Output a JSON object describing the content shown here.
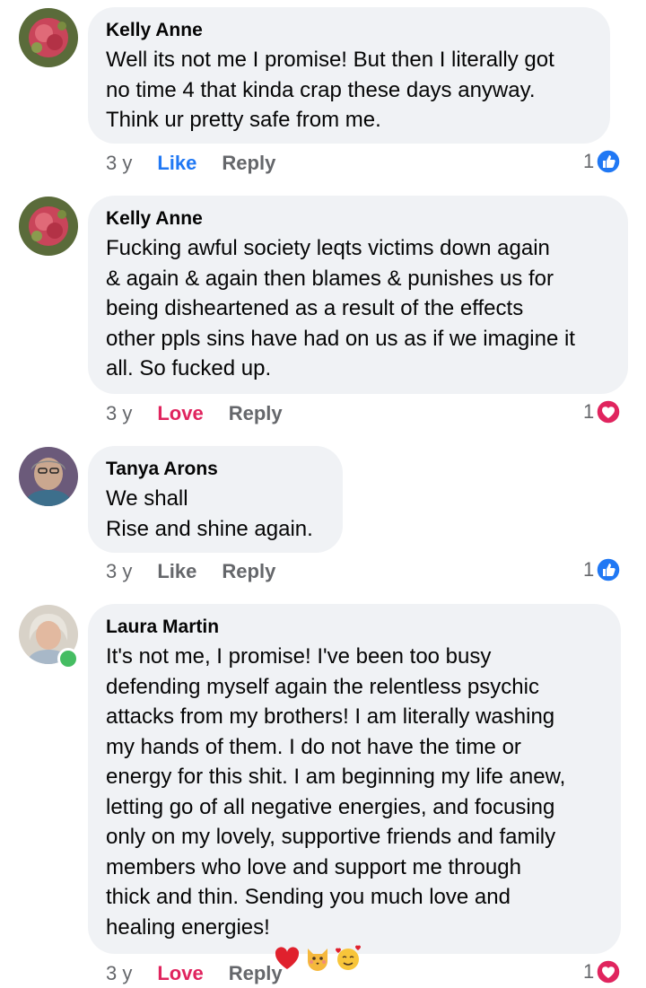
{
  "comments": [
    {
      "author": "Kelly Anne",
      "text": "Well its not me I promise! But then I literally got\nno time 4 that kinda crap these days anyway.\nThink ur pretty safe from me.",
      "time": "3 y",
      "reaction_label": "Like",
      "reply_label": "Reply",
      "reaction_count": "1",
      "reaction_icon": "like-icon"
    },
    {
      "author": "Kelly Anne",
      "text": "Fucking awful society leqts victims down again\n& again & again then blames & punishes us for\nbeing disheartened as a result of the effects\nother ppls sins have had on us as if we imagine it\nall. So fucked up.",
      "time": "3 y",
      "reaction_label": "Love",
      "reply_label": "Reply",
      "reaction_count": "1",
      "reaction_icon": "love-icon"
    },
    {
      "author": "Tanya Arons",
      "text": "We shall\nRise and shine again.",
      "time": "3 y",
      "reaction_label": "Like",
      "reply_label": "Reply",
      "reaction_count": "1",
      "reaction_icon": "like-icon"
    },
    {
      "author": "Laura Martin",
      "text": "It's not me, I promise! I've been too busy\ndefending myself again the relentless psychic\nattacks from my brothers! I am literally washing\nmy hands of them. I do not have the time or\nenergy for this shit. I am beginning my life anew,\nletting go of all negative energies, and focusing\nonly on my lovely, supportive friends and family\nmembers who love and support me through\nthick and thin. Sending you much love and\nhealing energies!",
      "time": "3 y",
      "reaction_label": "Love",
      "reply_label": "Reply",
      "reaction_count": "1",
      "reaction_icon": "love-icon",
      "emojis": [
        "red-heart-emoji",
        "kissing-cat-emoji",
        "smiling-face-with-hearts-emoji"
      ]
    }
  ],
  "colors": {
    "like_blue": "#2078f4",
    "love_red": "#e0245e",
    "bubble_bg": "#f0f2f5",
    "meta_gray": "#65676b",
    "online_green": "#45bd62"
  }
}
